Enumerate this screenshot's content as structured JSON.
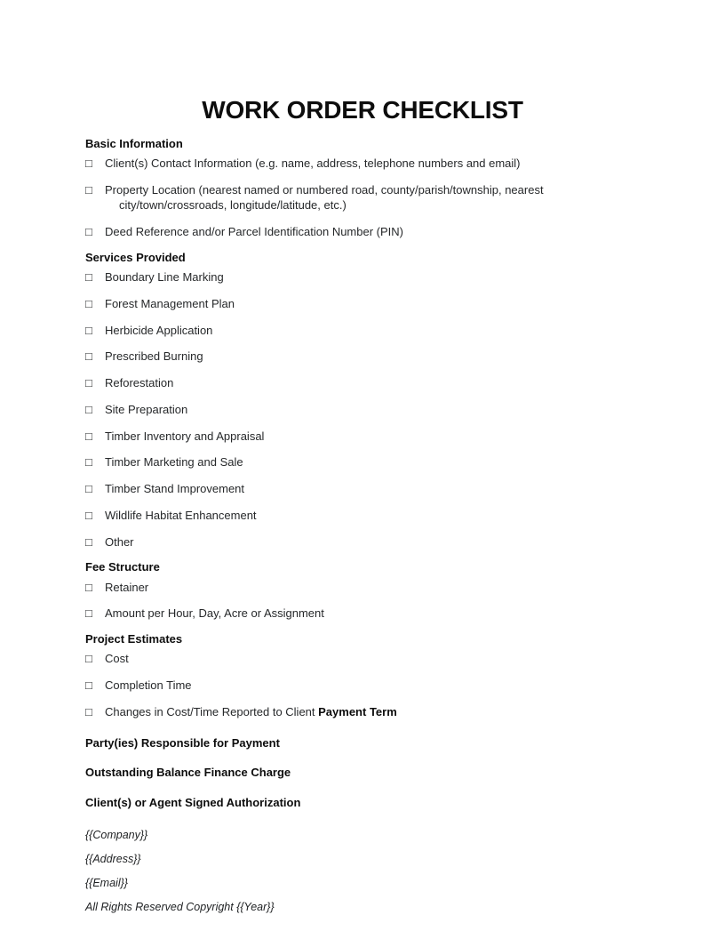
{
  "document": {
    "title": "WORK ORDER CHECKLIST",
    "checkbox_glyph": "□",
    "sections": [
      {
        "heading": "Basic Information",
        "items": [
          {
            "text": "Client(s) Contact Information (e.g. name, address, telephone numbers and email)",
            "continuation": ""
          },
          {
            "text": "Property Location (nearest named or numbered road, county/parish/township, nearest",
            "continuation": "city/town/crossroads, longitude/latitude, etc.)"
          },
          {
            "text": "Deed Reference and/or Parcel Identification Number (PIN)",
            "continuation": ""
          }
        ]
      },
      {
        "heading": "Services Provided",
        "items": [
          {
            "text": "Boundary Line Marking",
            "continuation": ""
          },
          {
            "text": "Forest Management Plan",
            "continuation": ""
          },
          {
            "text": "Herbicide Application",
            "continuation": ""
          },
          {
            "text": "Prescribed Burning",
            "continuation": ""
          },
          {
            "text": "Reforestation",
            "continuation": ""
          },
          {
            "text": "Site Preparation",
            "continuation": ""
          },
          {
            "text": "Timber Inventory and Appraisal",
            "continuation": ""
          },
          {
            "text": "Timber Marketing and Sale",
            "continuation": ""
          },
          {
            "text": "Timber Stand Improvement",
            "continuation": ""
          },
          {
            "text": "Wildlife Habitat Enhancement",
            "continuation": ""
          },
          {
            "text": "Other",
            "continuation": ""
          }
        ]
      },
      {
        "heading": "Fee Structure",
        "items": [
          {
            "text": "Retainer",
            "continuation": ""
          },
          {
            "text": "Amount per Hour, Day, Acre or Assignment",
            "continuation": ""
          }
        ]
      },
      {
        "heading": "Project Estimates",
        "items": [
          {
            "text": "Cost",
            "continuation": ""
          },
          {
            "text": "Completion Time",
            "continuation": ""
          },
          {
            "text": "Changes in Cost/Time Reported to Client ",
            "bold_suffix": "Payment Term",
            "continuation": ""
          }
        ]
      }
    ],
    "statements": [
      "Party(ies) Responsible for Payment",
      "Outstanding Balance Finance Charge",
      "Client(s) or Agent Signed Authorization"
    ],
    "footer": [
      "{{Company}}",
      "{{Address}}",
      "{{Email}}",
      "All Rights Reserved Copyright {{Year}}"
    ]
  }
}
